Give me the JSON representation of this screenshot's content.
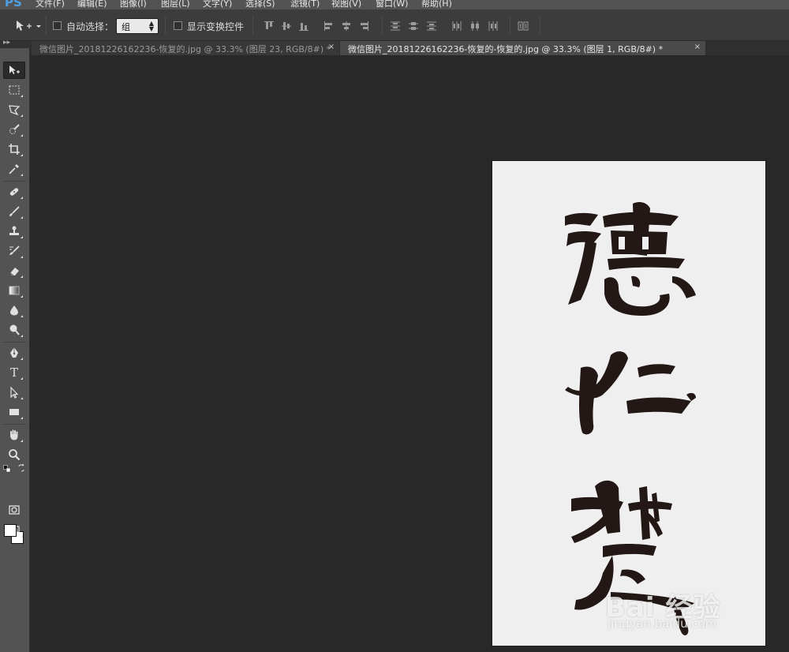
{
  "app": {
    "logo": "PS",
    "menu": [
      "文件(F)",
      "编辑(E)",
      "图像(I)",
      "图层(L)",
      "文字(Y)",
      "选择(S)",
      "滤镜(T)",
      "视图(V)",
      "窗口(W)",
      "帮助(H)"
    ]
  },
  "options": {
    "auto_select_label": "自动选择：",
    "auto_select_checked": false,
    "auto_select_value": "组",
    "show_transform_label": "显示变换控件",
    "show_transform_checked": false
  },
  "toolbar": {
    "collapse_glyph": "▸▸",
    "type_tool_glyph": "T",
    "foreground_color": "#ffffff",
    "background_color": "#ffffff",
    "tools": [
      "move-tool",
      "marquee-tool",
      "lasso-tool",
      "quick-selection-tool",
      "crop-tool",
      "eyedropper-tool",
      "healing-brush-tool",
      "brush-tool",
      "clone-stamp-tool",
      "history-brush-tool",
      "eraser-tool",
      "gradient-tool",
      "blur-tool",
      "dodge-tool",
      "pen-tool",
      "type-tool",
      "path-selection-tool",
      "rectangle-tool",
      "hand-tool",
      "zoom-tool",
      "quick-mask-button",
      "screen-mode-button"
    ]
  },
  "tabs": [
    {
      "title": "微信图片_20181226162236-恢复的.jpg @ 33.3% (图层 23, RGB/8#) *",
      "close": "×",
      "active": false
    },
    {
      "title": "微信图片_20181226162236-恢复的-恢复的.jpg @ 33.3% (图层 1, RGB/8#) *",
      "close": "×",
      "active": true
    }
  ],
  "document": {
    "canvas_color": "#efefef",
    "ink_color": "#231815",
    "calligraphy": "德仁楚"
  },
  "watermark": {
    "main": "Bai 经验",
    "sub": "jingyan.baidu.com"
  }
}
